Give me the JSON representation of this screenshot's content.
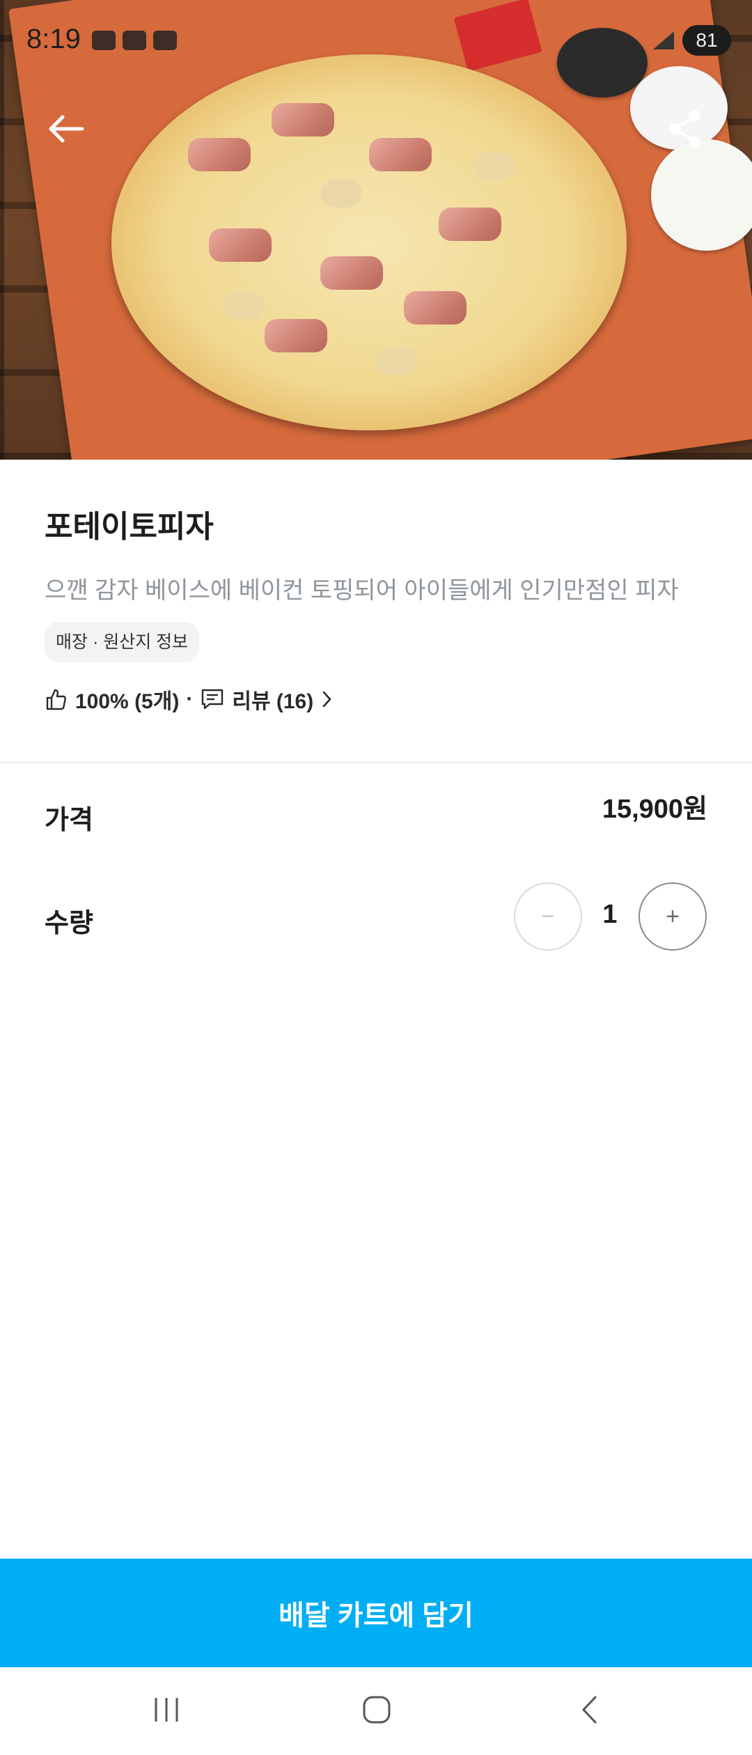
{
  "status_bar": {
    "time": "8:19",
    "battery": "81"
  },
  "header": {
    "back_icon": "arrow-left-icon",
    "share_icon": "share-icon"
  },
  "product": {
    "name": "포테이토피자",
    "description": "으깬 감자 베이스에 베이컨 토핑되어 아이들에게 인기만점인 피자",
    "info_chip": "매장 · 원산지 정보",
    "rating": "100% (5개)",
    "separator": "·",
    "review_label": "리뷰 (16)"
  },
  "options": {
    "price_label": "가격",
    "price_value": "15,900원",
    "quantity_label": "수량",
    "quantity_value": "1",
    "minus_label": "−",
    "plus_label": "+"
  },
  "cta": {
    "label": "배달 카트에 담기",
    "color": "#00aef5"
  },
  "system_nav": {
    "recent_icon": "recent-apps-icon",
    "home_icon": "home-icon",
    "back_icon": "back-chevron-icon"
  }
}
